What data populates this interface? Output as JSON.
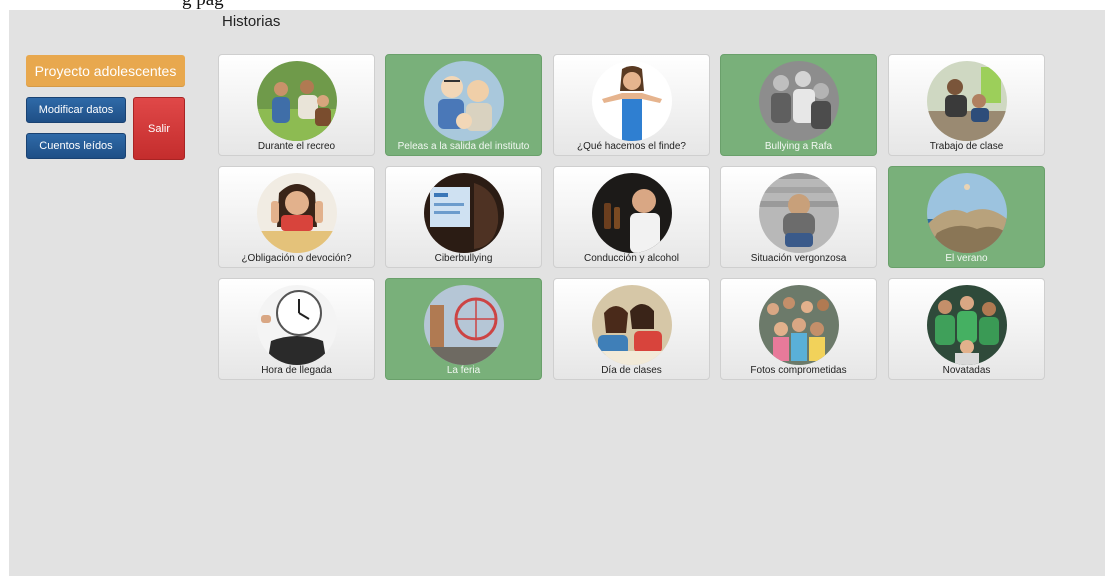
{
  "header_fragment": "g                                                                          pág",
  "section_title": "Historias",
  "sidebar": {
    "project_label": "Proyecto adolescentes",
    "modify_label": "Modificar datos",
    "read_label": "Cuentos leídos",
    "exit_label": "Salir"
  },
  "colors": {
    "read_card": "#79b07a",
    "project_button": "#e8a84e",
    "blue_button": "#2f6aa8",
    "exit_button": "#d63b3b"
  },
  "stories": [
    {
      "label": "Durante el recreo",
      "read": false
    },
    {
      "label": "Peleas a la salida del instituto",
      "read": true
    },
    {
      "label": "¿Qué hacemos el finde?",
      "read": false
    },
    {
      "label": "Bullying a Rafa",
      "read": true
    },
    {
      "label": "Trabajo de clase",
      "read": false
    },
    {
      "label": "¿Obligación o devoción?",
      "read": false
    },
    {
      "label": "Ciberbullying",
      "read": false
    },
    {
      "label": "Conducción y alcohol",
      "read": false
    },
    {
      "label": "Situación vergonzosa",
      "read": false
    },
    {
      "label": "El verano",
      "read": true
    },
    {
      "label": "Hora de llegada",
      "read": false
    },
    {
      "label": "La feria",
      "read": true
    },
    {
      "label": "Día de clases",
      "read": false
    },
    {
      "label": "Fotos comprometidas",
      "read": false
    },
    {
      "label": "Novatadas",
      "read": false
    }
  ]
}
